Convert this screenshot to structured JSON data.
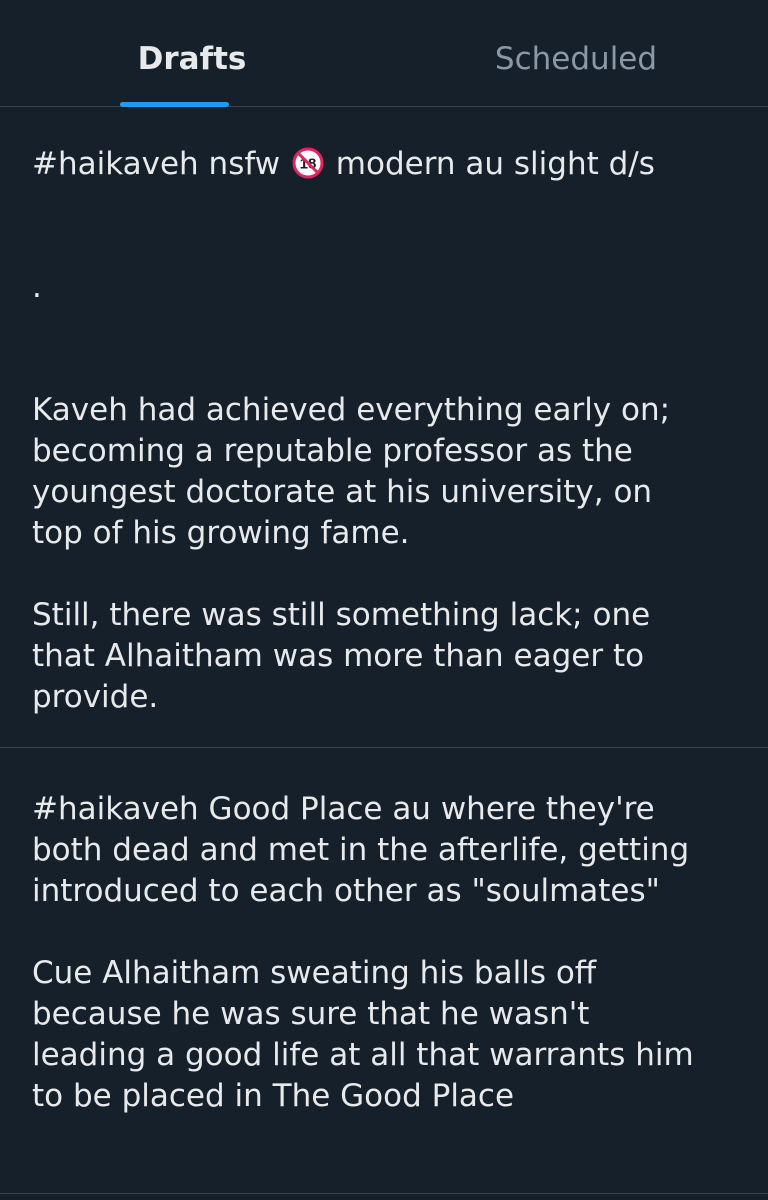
{
  "tabs": {
    "drafts_label": "Drafts",
    "scheduled_label": "Scheduled",
    "active": "Drafts"
  },
  "colors": {
    "background": "#15202b",
    "text": "#e7e9ea",
    "muted": "#8b98a5",
    "accent": "#1d9bf0",
    "divider": "#38444d"
  },
  "drafts": [
    {
      "line1_before": "#haikaveh nsfw ",
      "line1_icon": "no-under-18-icon",
      "line1_after": " modern au slight d/s",
      "dot": ".",
      "para1": "Kaveh had achieved everything early on;\nbecoming a reputable professor as the\nyoungest doctorate at his university, on\ntop of his growing fame.",
      "para2": "Still, there was still something lack; one\nthat Alhaitham was more than eager to\nprovide."
    },
    {
      "para1": "#haikaveh Good Place au where they're\nboth dead and met in the afterlife, getting\nintroduced to each other as \"soulmates\"",
      "para2": "Cue Alhaitham sweating his balls off\nbecause he was sure that he wasn't\nleading a good life at all that warrants him\nto be placed in The Good Place"
    }
  ]
}
